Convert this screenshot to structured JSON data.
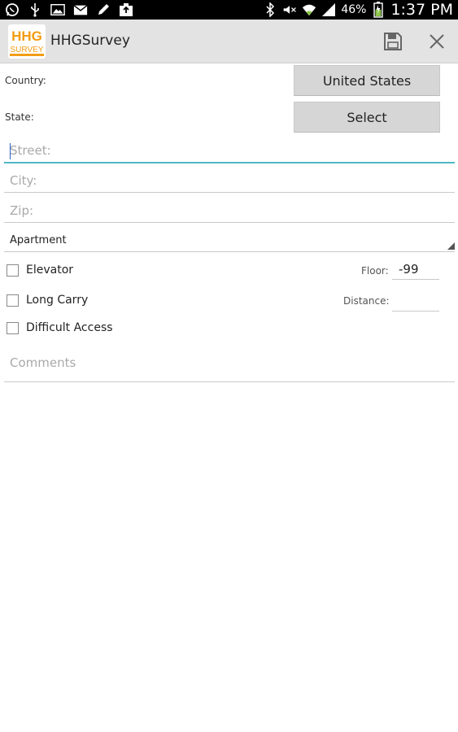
{
  "status_bar": {
    "left_icons": [
      "whatsapp-icon",
      "usb-icon",
      "image-icon",
      "mail-icon",
      "pencil-icon",
      "upload-icon"
    ],
    "right_icons": [
      "bluetooth-icon",
      "mute-icon",
      "wifi-icon",
      "signal-icon",
      "battery-icon"
    ],
    "battery_percent": "46%",
    "time": "1:37 PM"
  },
  "action_bar": {
    "title": "HHGSurvey",
    "logo_text_top": "HHG",
    "logo_text_bottom": "SURVEY",
    "actions": [
      "save-icon",
      "close-icon"
    ]
  },
  "colors": {
    "accent": "#4fb8c9",
    "logo_orange": "#f39c12",
    "action_bar_bg": "#e3e3e3",
    "button_bg": "#d6d6d6"
  },
  "form": {
    "country_label": "Country:",
    "country_value": "United States",
    "state_label": "State:",
    "state_value": "Select",
    "street_placeholder": "Street:",
    "city_placeholder": "City:",
    "zip_placeholder": "Zip:",
    "residence_type": "Apartment",
    "elevator_label": "Elevator",
    "elevator_checked": false,
    "long_carry_label": "Long Carry",
    "long_carry_checked": false,
    "difficult_access_label": "Difficult Access",
    "difficult_access_checked": false,
    "floor_label": "Floor:",
    "floor_value": "-99",
    "distance_label": "Distance:",
    "distance_value": "",
    "comments_placeholder": "Comments"
  }
}
